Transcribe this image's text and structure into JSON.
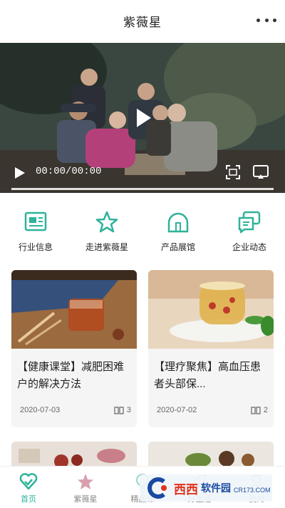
{
  "header": {
    "title": "紫薇星",
    "more_icon": "more-dots-icon"
  },
  "video": {
    "time": "00:00/00:00",
    "progress": 0
  },
  "nav_grid": [
    {
      "label": "行业信息",
      "icon": "newspaper-icon"
    },
    {
      "label": "走进紫薇星",
      "icon": "star-icon"
    },
    {
      "label": "产品展馆",
      "icon": "dome-icon"
    },
    {
      "label": "企业动态",
      "icon": "chat-icon"
    }
  ],
  "cards": [
    {
      "title": "【健康课堂】减肥困难户的解决方法",
      "date": "2020-07-03",
      "views": "3"
    },
    {
      "title": "【理疗聚焦】高血压患者头部保...",
      "date": "2020-07-02",
      "views": "2"
    }
  ],
  "tabbar": [
    {
      "label": "首页",
      "icon": "heart-check-icon",
      "active": true
    },
    {
      "label": "紫薇星",
      "icon": "star-icon",
      "active": false
    },
    {
      "label": "精品课",
      "icon": "lightbulb-icon",
      "active": false
    },
    {
      "label": "好生活",
      "icon": "leaf-icon",
      "active": false
    },
    {
      "label": "我的",
      "icon": "person-icon",
      "active": false
    }
  ],
  "watermark": {
    "brand": "西西",
    "brand2": "软件园",
    "site": "CR173.COM"
  },
  "colors": {
    "accent": "#2eb39a",
    "card_bg": "#f5f5f5"
  }
}
